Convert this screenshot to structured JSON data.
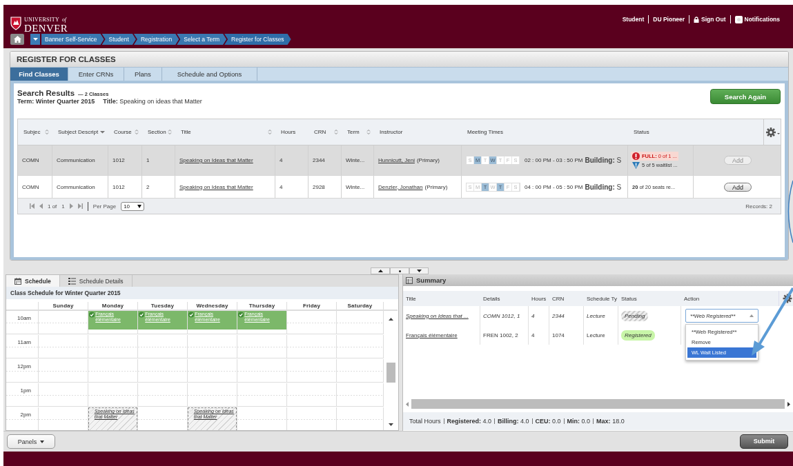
{
  "header": {
    "logo": {
      "top": "UNIVERSITY",
      "of": "of",
      "bottom": "DENVER"
    },
    "user_links": [
      {
        "label": "Student",
        "kind": "text"
      },
      {
        "label": "DU Pioneer",
        "kind": "text"
      },
      {
        "label": "Sign Out",
        "kind": "lock"
      },
      {
        "label": "Notifications",
        "kind": "bell"
      }
    ],
    "breadcrumbs": [
      "Banner Self-Service",
      "Student",
      "Registration",
      "Select a Term",
      "Register for Classes"
    ]
  },
  "page_title": "REGISTER FOR CLASSES",
  "tabs": [
    {
      "label": "Find Classes",
      "selected": true
    },
    {
      "label": "Enter CRNs",
      "selected": false
    },
    {
      "label": "Plans",
      "selected": false
    },
    {
      "label": "Schedule and Options",
      "selected": false
    }
  ],
  "search": {
    "heading": "Search Results",
    "count": "— 2 Classes",
    "term_label": "Term:",
    "term": "Winter Quarter 2015",
    "title_label": "Title:",
    "title": "Speaking on ideas that Matter",
    "button": "Search Again"
  },
  "results": {
    "columns": [
      {
        "label": "Subjec",
        "sortable": true,
        "sorted": false
      },
      {
        "label": "Subject Descript",
        "sortable": true,
        "sorted": true
      },
      {
        "label": "Course",
        "sortable": true,
        "sorted": false
      },
      {
        "label": "Section",
        "sortable": true,
        "sorted": false
      },
      {
        "label": "Title",
        "sortable": true,
        "sorted": false
      },
      {
        "label": "Hours",
        "sortable": false
      },
      {
        "label": "CRN",
        "sortable": true,
        "sorted": false
      },
      {
        "label": "Term",
        "sortable": true,
        "sorted": false
      },
      {
        "label": "Instructor",
        "sortable": false
      },
      {
        "label": "Meeting Times",
        "sortable": false
      },
      {
        "label": "Status",
        "sortable": false
      }
    ],
    "rows": [
      {
        "selected": true,
        "subject": "COMN",
        "description": "Communication",
        "course": "1012",
        "section": "1",
        "title": "Speaking on Ideas that Matter",
        "hours": "4",
        "crn": "2344",
        "term": "Winte...",
        "instructor": "Hunnicutt, Jeni",
        "role": "(Primary)",
        "days": [
          {
            "label": "S",
            "on": false
          },
          {
            "label": "M",
            "on": true
          },
          {
            "label": "T",
            "on": false
          },
          {
            "label": "W",
            "on": true
          },
          {
            "label": "T",
            "on": false
          },
          {
            "label": "F",
            "on": false
          },
          {
            "label": "S",
            "on": false
          }
        ],
        "time": "02 : 00 PM - 03 : 50 PM",
        "building": "**Building:** S",
        "status": [
          {
            "kind": "full",
            "text": "**FULL:** 0 of 1 ..."
          },
          {
            "kind": "waitlist",
            "text": "5 of 5 waitlist ..."
          }
        ],
        "add": {
          "label": "Add",
          "disabled": true
        }
      },
      {
        "selected": false,
        "subject": "COMN",
        "description": "Communication",
        "course": "1012",
        "section": "2",
        "title": "Speaking on Ideas that Matter",
        "hours": "4",
        "crn": "2928",
        "term": "Winte...",
        "instructor": "Denzler, Jonathan",
        "role": "(Primary)",
        "days": [
          {
            "label": "S",
            "on": false
          },
          {
            "label": "M",
            "on": false
          },
          {
            "label": "T",
            "on": true
          },
          {
            "label": "W",
            "on": false
          },
          {
            "label": "T",
            "on": true
          },
          {
            "label": "F",
            "on": false
          },
          {
            "label": "S",
            "on": false
          }
        ],
        "time": "04 : 00 PM - 05 : 50 PM",
        "building": "**Building:** S",
        "status": [
          {
            "kind": "seats",
            "text": "**20** of 20 seats re..."
          }
        ],
        "add": {
          "label": "Add",
          "disabled": false
        }
      }
    ],
    "pager": {
      "page": "1 of",
      "total": "1",
      "per_page_label": "Per Page",
      "per_page": "10",
      "records": "Records: 2"
    }
  },
  "bottom_tabs": [
    {
      "label": "Schedule",
      "kind": "calendar",
      "selected": true
    },
    {
      "label": "Schedule Details",
      "kind": "list",
      "selected": false
    }
  ],
  "schedule": {
    "title": "Class Schedule for Winter Quarter 2015",
    "days": [
      "Sunday",
      "Monday",
      "Tuesday",
      "Wednesday",
      "Thursday",
      "Friday",
      "Saturday"
    ],
    "rows": [
      {
        "time": "10am",
        "cells": [
          null,
          {
            "title": "Français élémentaire",
            "kind": "registered"
          },
          {
            "title": "Français élémentaire",
            "kind": "registered"
          },
          {
            "title": "Français élémentaire",
            "kind": "registered"
          },
          {
            "title": "Français élémentaire",
            "kind": "registered"
          },
          null,
          null
        ]
      },
      {
        "time": "11am",
        "cells": [
          null,
          null,
          null,
          null,
          null,
          null,
          null
        ]
      },
      {
        "time": "12pm",
        "cells": [
          null,
          null,
          null,
          null,
          null,
          null,
          null
        ]
      },
      {
        "time": "1pm",
        "cells": [
          null,
          null,
          null,
          null,
          null,
          null,
          null
        ]
      },
      {
        "time": "2pm",
        "cells": [
          null,
          {
            "title": "Speaking on Ideas that Matter",
            "kind": "pending"
          },
          null,
          {
            "title": "Speaking on Ideas that Matter",
            "kind": "pending"
          },
          null,
          null,
          null
        ]
      }
    ]
  },
  "summary": {
    "title": "Summary",
    "columns": [
      "Title",
      "Details",
      "Hours",
      "CRN",
      "Schedule Ty",
      "Status",
      "Action"
    ],
    "rows": [
      {
        "title": "Speaking on Ideas that ...",
        "details": "COMN 1012, 1",
        "hours": "4",
        "crn": "2344",
        "schedule_type": "Lecture",
        "status": {
          "label": "Pending",
          "kind": "pending"
        }
      },
      {
        "title": "Français élémentaire",
        "details": "FREN 1002, 2",
        "hours": "4",
        "crn": "1074",
        "schedule_type": "Lecture",
        "status": {
          "label": "Registered",
          "kind": "registered"
        }
      }
    ],
    "action": {
      "value": "**Web Registered**",
      "expanded": true,
      "options": [
        {
          "label": "**Web Registered**",
          "highlighted": false
        },
        {
          "label": "Remove",
          "highlighted": false
        },
        {
          "label": "WL Wait Listed",
          "highlighted": true
        }
      ]
    },
    "totals": [
      {
        "label": "Total Hours"
      },
      {
        "label": "Registered:",
        "value": "4.0"
      },
      {
        "label": "Billing:",
        "value": "4.0"
      },
      {
        "label": "CEU:",
        "value": "0.0"
      },
      {
        "label": "Min:",
        "value": "0.0"
      },
      {
        "label": "Max:",
        "value": "18.0"
      }
    ]
  },
  "footer": {
    "panels": "Panels",
    "submit": "Submit"
  }
}
